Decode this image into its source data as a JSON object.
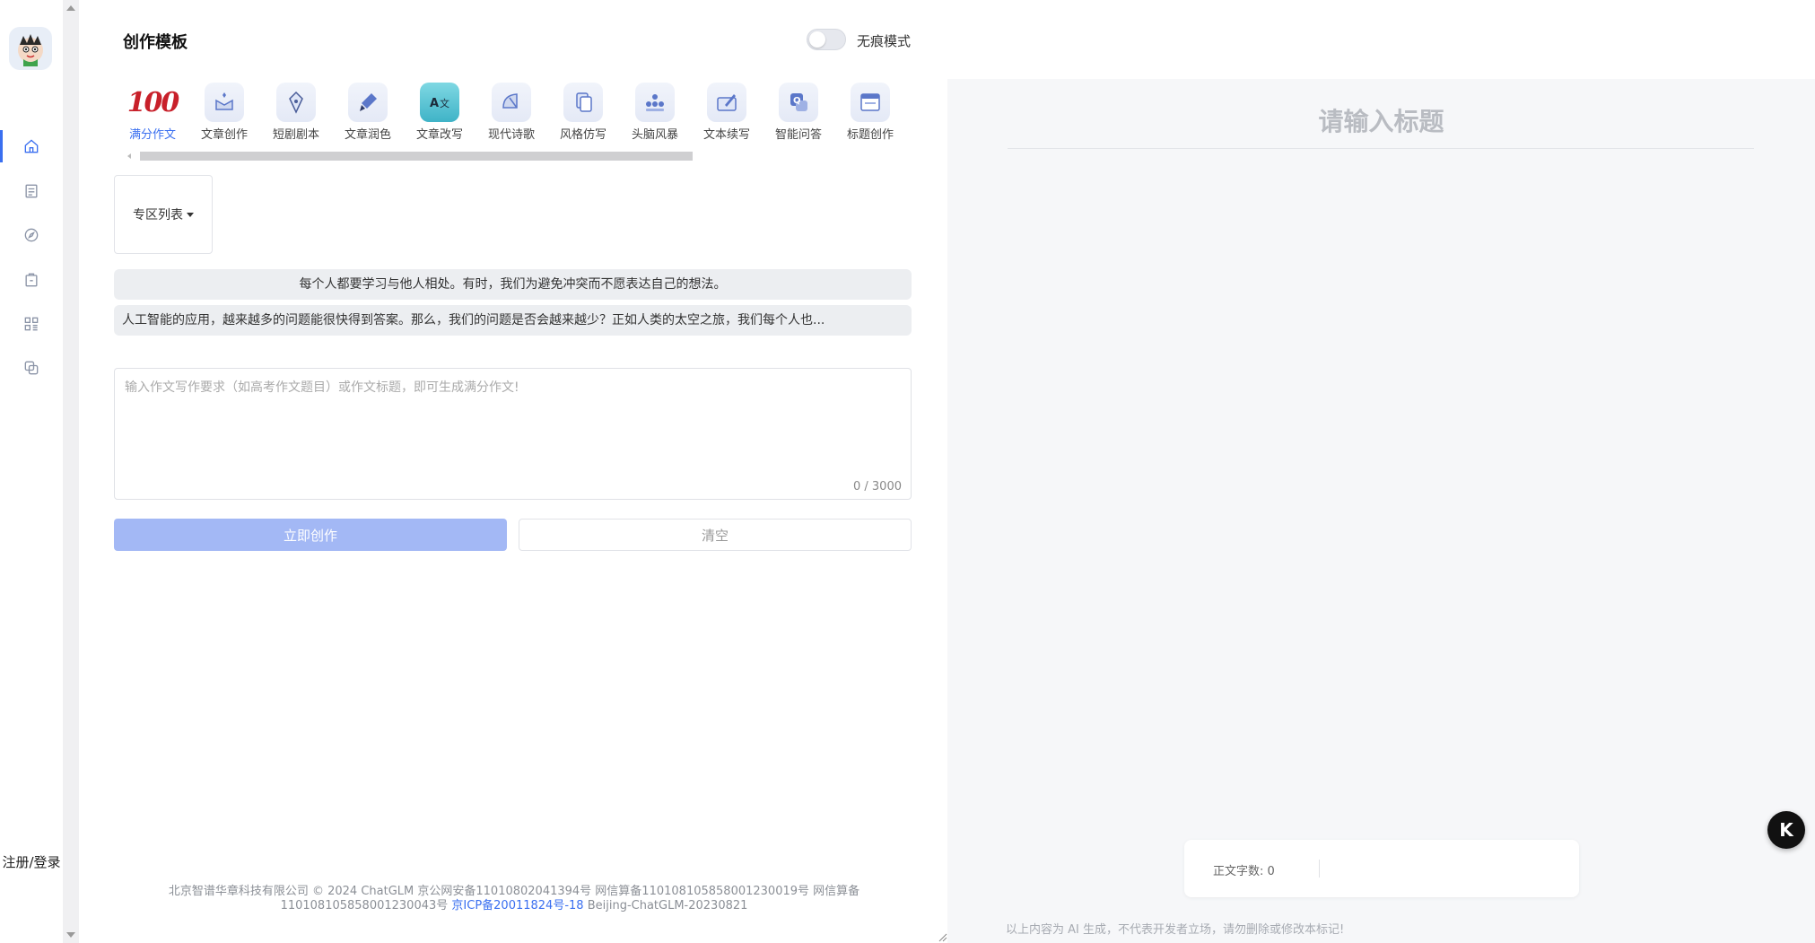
{
  "header": {
    "title": "创作模板",
    "toggle_label": "无痕模式",
    "toggle_on": false
  },
  "nav": {
    "login": "注册/登录"
  },
  "tools": [
    {
      "label": "满分作文",
      "icon": "hundred-icon",
      "active": true
    },
    {
      "label": "文章创作",
      "icon": "article-icon"
    },
    {
      "label": "短剧剧本",
      "icon": "pen-nib-icon"
    },
    {
      "label": "文章润色",
      "icon": "brush-icon"
    },
    {
      "label": "文章改写",
      "icon": "translate-icon"
    },
    {
      "label": "现代诗歌",
      "icon": "fan-icon"
    },
    {
      "label": "风格仿写",
      "icon": "copy-icon"
    },
    {
      "label": "头脑风暴",
      "icon": "group-icon"
    },
    {
      "label": "文本续写",
      "icon": "edit-box-icon"
    },
    {
      "label": "智能问答",
      "icon": "qa-icon"
    },
    {
      "label": "标题创作",
      "icon": "window-icon"
    }
  ],
  "zone": {
    "label": "专区列表"
  },
  "suggestions": [
    "每个人都要学习与他人相处。有时，我们为避免冲突而不愿表达自己的想法。",
    "人工智能的应用，越来越多的问题能很快得到答案。那么，我们的问题是否会越来越少？正如人类的太空之旅，我们每个人也..."
  ],
  "input": {
    "placeholder": "输入作文写作要求（如高考作文题目）或作文标题，即可生成满分作文!",
    "count": "0 / 3000"
  },
  "buttons": {
    "create": "立即创作",
    "clear": "清空"
  },
  "footer": {
    "line1": "北京智谱华章科技有限公司 © 2024 ChatGLM 京公网安备11010802041394号 网信算备110108105858001230019号 网信算备",
    "line2_prefix": "110108105858001230043号",
    "icp": "京ICP备20011824号-18",
    "line2_suffix": "Beijing-ChatGLM-20230821"
  },
  "editor": {
    "title_placeholder": "请输入标题",
    "word_count_label": "正文字数:",
    "word_count": "0",
    "disclaimer": "以上内容为 AI 生成，不代表开发者立场，请勿删除或修改本标记!"
  },
  "fab": {
    "label": "K"
  }
}
